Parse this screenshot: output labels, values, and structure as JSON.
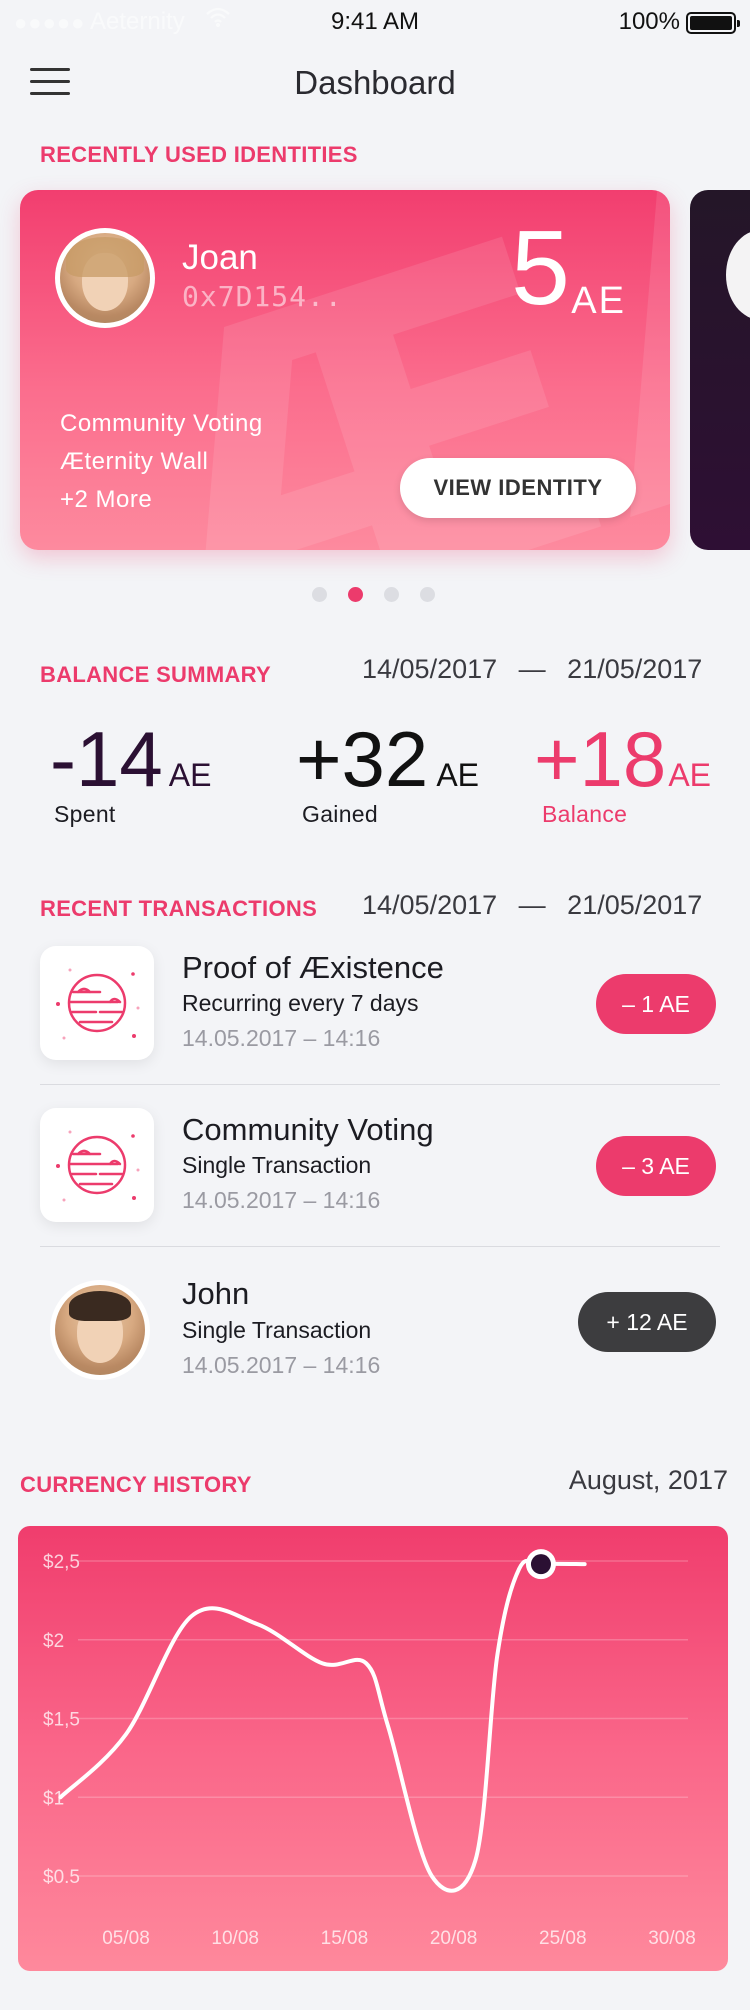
{
  "status_bar": {
    "signal": "●●●●●",
    "carrier": "Aeternity",
    "time": "9:41 AM",
    "battery": "100%"
  },
  "header": {
    "title": "Dashboard"
  },
  "identities": {
    "section_label": "RECENTLY USED IDENTITIES",
    "card": {
      "name": "Joan",
      "address": "0x7D154..",
      "amount": "5",
      "unit": "AE",
      "apps": [
        "Community Voting",
        "Æternity Wall",
        "+2 More"
      ],
      "button": "VIEW IDENTITY",
      "watermark": "ÆÆ"
    },
    "pager": {
      "count": 4,
      "active_index": 1
    }
  },
  "balance": {
    "section_label": "BALANCE SUMMARY",
    "date_from": "14/05/2017",
    "date_to": "21/05/2017",
    "separator": "—",
    "spent": {
      "value": "-14",
      "unit": "AE",
      "label": "Spent"
    },
    "gained": {
      "value": "+32",
      "unit": "AE",
      "label": "Gained"
    },
    "total": {
      "value": "+18",
      "unit": "AE",
      "label": "Balance"
    }
  },
  "transactions": {
    "section_label": "RECENT TRANSACTIONS",
    "date_from": "14/05/2017",
    "date_to": "21/05/2017",
    "separator": "—",
    "items": [
      {
        "title": "Proof of Æxistence",
        "subtitle": "Recurring every 7 days",
        "date": "14.05.2017 – 14:16",
        "amount": "– 1 AE",
        "badge_color": "#ec3b6c"
      },
      {
        "title": "Community Voting",
        "subtitle": "Single Transaction",
        "date": "14.05.2017 – 14:16",
        "amount": "– 3 AE",
        "badge_color": "#ec3b6c"
      },
      {
        "title": "John",
        "subtitle": "Single Transaction",
        "date": "14.05.2017 – 14:16",
        "amount": "+ 12 AE",
        "badge_color": "#3d3d3f"
      }
    ]
  },
  "currency_history": {
    "section_label": "CURRENCY HISTORY",
    "period": "August, 2017"
  },
  "colors": {
    "accent": "#ec3b6c",
    "dark": "#2b1033",
    "text": "#1c1c22"
  },
  "chart_data": {
    "type": "line",
    "x_ticks": [
      "05/08",
      "10/08",
      "15/08",
      "20/08",
      "25/08",
      "30/08"
    ],
    "y_ticks": [
      "$0.5",
      "$1",
      "$1,5",
      "$2",
      "$2,5"
    ],
    "ylim": [
      0.5,
      2.5
    ],
    "grid": true,
    "series": [
      {
        "x": [
          "02/08",
          "05/08",
          "08/08",
          "11/08",
          "14/08",
          "16/08",
          "17/08",
          "19/08",
          "21/08",
          "22/08",
          "23/08",
          "24/08",
          "26/08"
        ],
        "values": [
          1.0,
          1.4,
          2.15,
          2.1,
          1.85,
          1.85,
          1.45,
          0.5,
          0.6,
          1.9,
          2.45,
          2.48,
          2.48
        ]
      }
    ],
    "highlight": {
      "x": "24/08",
      "value": 2.48
    }
  }
}
